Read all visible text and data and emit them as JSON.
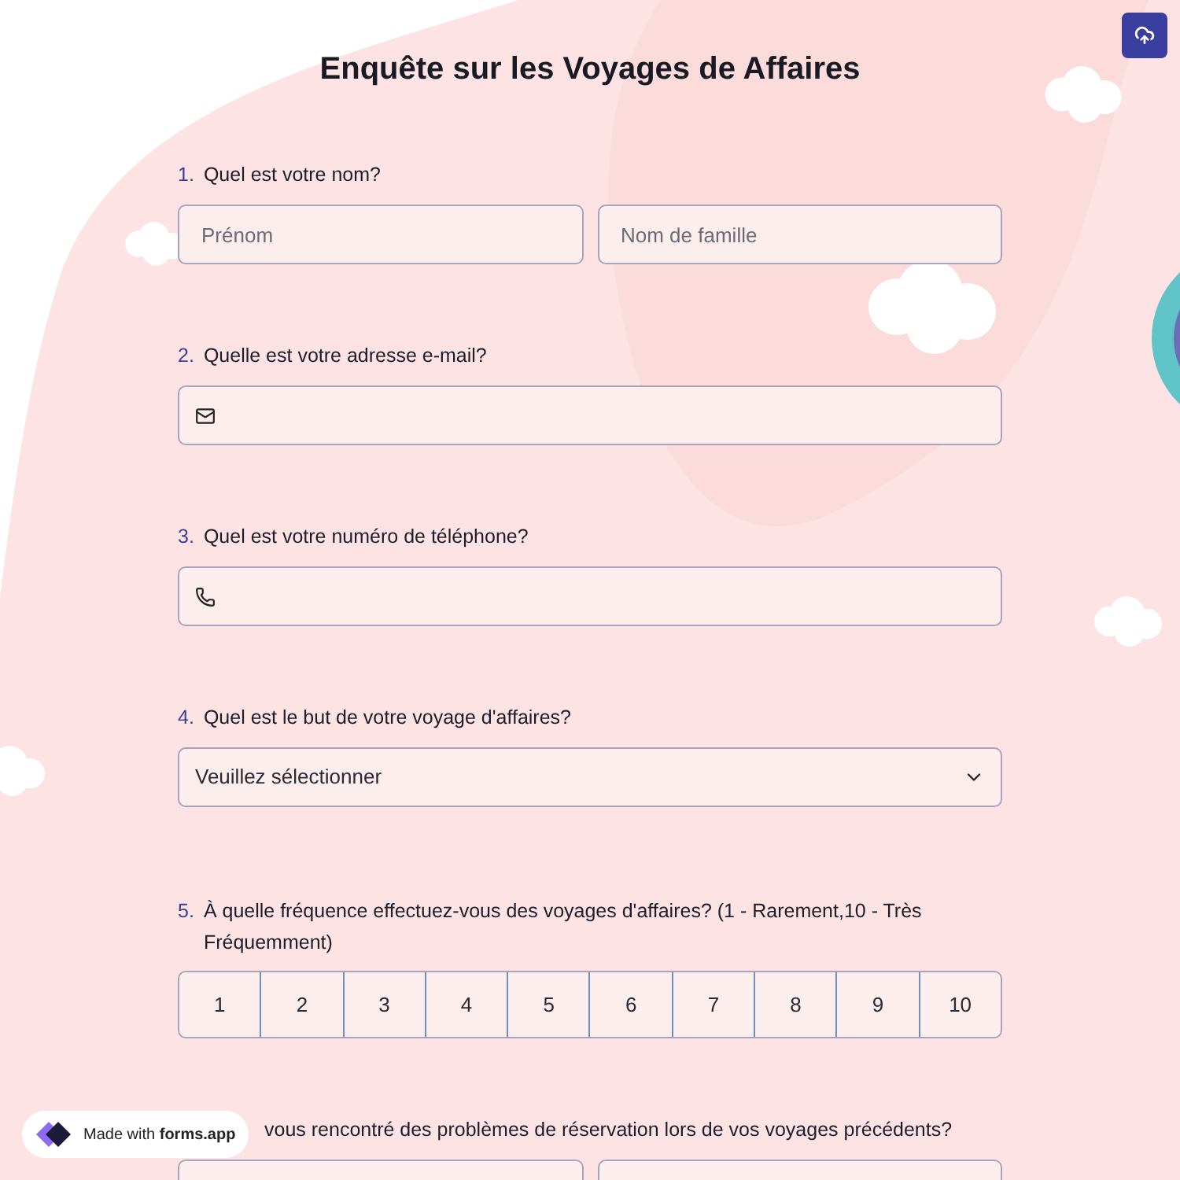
{
  "title": "Enquête sur les Voyages de Affaires",
  "questions": [
    {
      "kind": "name",
      "number": "1.",
      "label": "Quel est votre nom?",
      "fields": [
        {
          "placeholder": "Prénom"
        },
        {
          "placeholder": "Nom de famille"
        }
      ]
    },
    {
      "kind": "email",
      "number": "2.",
      "label": "Quelle est votre adresse e-mail?"
    },
    {
      "kind": "phone",
      "number": "3.",
      "label": "Quel est votre numéro de téléphone?"
    },
    {
      "kind": "select",
      "number": "4.",
      "label": "Quel est le but de votre voyage d'affaires?",
      "value": "Veuillez sélectionner"
    },
    {
      "kind": "scale",
      "number": "5.",
      "label": "À quelle fréquence effectuez-vous des voyages d'affaires? (1 - Rarement,10 - Très Fréquemment)",
      "options": [
        {
          "label": "1",
          "selected": false
        },
        {
          "label": "2",
          "selected": false
        },
        {
          "label": "3",
          "selected": false
        },
        {
          "label": "4",
          "selected": false
        },
        {
          "label": "5",
          "selected": false
        },
        {
          "label": "6",
          "selected": false
        },
        {
          "label": "7",
          "selected": false
        },
        {
          "label": "8",
          "selected": false
        },
        {
          "label": "9",
          "selected": false
        },
        {
          "label": "10",
          "selected": false
        }
      ]
    },
    {
      "kind": "choice",
      "label": "vous rencontré des problèmes de réservation lors de vos voyages précédents?"
    }
  ],
  "badge": "Made with **forms.app**"
}
